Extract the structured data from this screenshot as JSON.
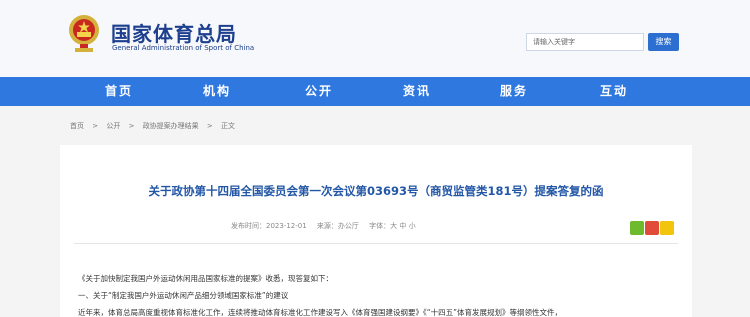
{
  "header": {
    "title_cn": "国家体育总局",
    "title_en": "General Administration of Sport of China"
  },
  "search": {
    "placeholder": "请输入关键字",
    "button_label": "搜索"
  },
  "nav": {
    "items": [
      {
        "label": "首页"
      },
      {
        "label": "机构"
      },
      {
        "label": "公开"
      },
      {
        "label": "资讯"
      },
      {
        "label": "服务"
      },
      {
        "label": "互动"
      }
    ]
  },
  "breadcrumb": {
    "items": [
      "首页",
      "公开",
      "政协提案办理结果",
      "正文"
    ],
    "separator": ">"
  },
  "article": {
    "title": "关于政协第十四届全国委员会第一次会议第03693号（商贸监管类181号）提案答复的函",
    "meta": {
      "date_label": "发布时间：2023-12-01",
      "source_label": "来源：办公厅",
      "font_label": "字体：大 中 小"
    },
    "paragraphs": [
      "《关于加快制定我国户外运动休闲用品国家标准的提案》收悉，现答复如下：",
      "一、关于“制定我国户外运动休闲产品细分领域国家标准”的建议",
      "近年来，体育总局高度重视体育标准化工作，连续将推动体育标准化工作建设写入《体育强国建设纲要》《“十四五”体育发展规划》等纲领性文件，"
    ]
  },
  "colors": {
    "brand": "#1d3f8e",
    "nav_bg": "#2e78e0",
    "title": "#2357a6"
  }
}
